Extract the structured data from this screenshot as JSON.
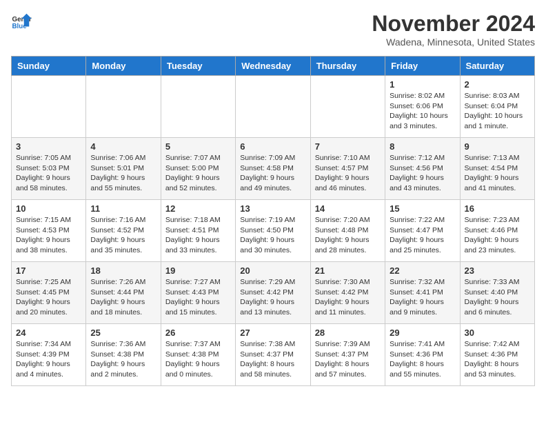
{
  "header": {
    "logo_general": "General",
    "logo_blue": "Blue",
    "month_title": "November 2024",
    "location": "Wadena, Minnesota, United States"
  },
  "days_of_week": [
    "Sunday",
    "Monday",
    "Tuesday",
    "Wednesday",
    "Thursday",
    "Friday",
    "Saturday"
  ],
  "weeks": [
    [
      {
        "day": "",
        "info": ""
      },
      {
        "day": "",
        "info": ""
      },
      {
        "day": "",
        "info": ""
      },
      {
        "day": "",
        "info": ""
      },
      {
        "day": "",
        "info": ""
      },
      {
        "day": "1",
        "info": "Sunrise: 8:02 AM\nSunset: 6:06 PM\nDaylight: 10 hours and 3 minutes."
      },
      {
        "day": "2",
        "info": "Sunrise: 8:03 AM\nSunset: 6:04 PM\nDaylight: 10 hours and 1 minute."
      }
    ],
    [
      {
        "day": "3",
        "info": "Sunrise: 7:05 AM\nSunset: 5:03 PM\nDaylight: 9 hours and 58 minutes."
      },
      {
        "day": "4",
        "info": "Sunrise: 7:06 AM\nSunset: 5:01 PM\nDaylight: 9 hours and 55 minutes."
      },
      {
        "day": "5",
        "info": "Sunrise: 7:07 AM\nSunset: 5:00 PM\nDaylight: 9 hours and 52 minutes."
      },
      {
        "day": "6",
        "info": "Sunrise: 7:09 AM\nSunset: 4:58 PM\nDaylight: 9 hours and 49 minutes."
      },
      {
        "day": "7",
        "info": "Sunrise: 7:10 AM\nSunset: 4:57 PM\nDaylight: 9 hours and 46 minutes."
      },
      {
        "day": "8",
        "info": "Sunrise: 7:12 AM\nSunset: 4:56 PM\nDaylight: 9 hours and 43 minutes."
      },
      {
        "day": "9",
        "info": "Sunrise: 7:13 AM\nSunset: 4:54 PM\nDaylight: 9 hours and 41 minutes."
      }
    ],
    [
      {
        "day": "10",
        "info": "Sunrise: 7:15 AM\nSunset: 4:53 PM\nDaylight: 9 hours and 38 minutes."
      },
      {
        "day": "11",
        "info": "Sunrise: 7:16 AM\nSunset: 4:52 PM\nDaylight: 9 hours and 35 minutes."
      },
      {
        "day": "12",
        "info": "Sunrise: 7:18 AM\nSunset: 4:51 PM\nDaylight: 9 hours and 33 minutes."
      },
      {
        "day": "13",
        "info": "Sunrise: 7:19 AM\nSunset: 4:50 PM\nDaylight: 9 hours and 30 minutes."
      },
      {
        "day": "14",
        "info": "Sunrise: 7:20 AM\nSunset: 4:48 PM\nDaylight: 9 hours and 28 minutes."
      },
      {
        "day": "15",
        "info": "Sunrise: 7:22 AM\nSunset: 4:47 PM\nDaylight: 9 hours and 25 minutes."
      },
      {
        "day": "16",
        "info": "Sunrise: 7:23 AM\nSunset: 4:46 PM\nDaylight: 9 hours and 23 minutes."
      }
    ],
    [
      {
        "day": "17",
        "info": "Sunrise: 7:25 AM\nSunset: 4:45 PM\nDaylight: 9 hours and 20 minutes."
      },
      {
        "day": "18",
        "info": "Sunrise: 7:26 AM\nSunset: 4:44 PM\nDaylight: 9 hours and 18 minutes."
      },
      {
        "day": "19",
        "info": "Sunrise: 7:27 AM\nSunset: 4:43 PM\nDaylight: 9 hours and 15 minutes."
      },
      {
        "day": "20",
        "info": "Sunrise: 7:29 AM\nSunset: 4:42 PM\nDaylight: 9 hours and 13 minutes."
      },
      {
        "day": "21",
        "info": "Sunrise: 7:30 AM\nSunset: 4:42 PM\nDaylight: 9 hours and 11 minutes."
      },
      {
        "day": "22",
        "info": "Sunrise: 7:32 AM\nSunset: 4:41 PM\nDaylight: 9 hours and 9 minutes."
      },
      {
        "day": "23",
        "info": "Sunrise: 7:33 AM\nSunset: 4:40 PM\nDaylight: 9 hours and 6 minutes."
      }
    ],
    [
      {
        "day": "24",
        "info": "Sunrise: 7:34 AM\nSunset: 4:39 PM\nDaylight: 9 hours and 4 minutes."
      },
      {
        "day": "25",
        "info": "Sunrise: 7:36 AM\nSunset: 4:38 PM\nDaylight: 9 hours and 2 minutes."
      },
      {
        "day": "26",
        "info": "Sunrise: 7:37 AM\nSunset: 4:38 PM\nDaylight: 9 hours and 0 minutes."
      },
      {
        "day": "27",
        "info": "Sunrise: 7:38 AM\nSunset: 4:37 PM\nDaylight: 8 hours and 58 minutes."
      },
      {
        "day": "28",
        "info": "Sunrise: 7:39 AM\nSunset: 4:37 PM\nDaylight: 8 hours and 57 minutes."
      },
      {
        "day": "29",
        "info": "Sunrise: 7:41 AM\nSunset: 4:36 PM\nDaylight: 8 hours and 55 minutes."
      },
      {
        "day": "30",
        "info": "Sunrise: 7:42 AM\nSunset: 4:36 PM\nDaylight: 8 hours and 53 minutes."
      }
    ]
  ]
}
